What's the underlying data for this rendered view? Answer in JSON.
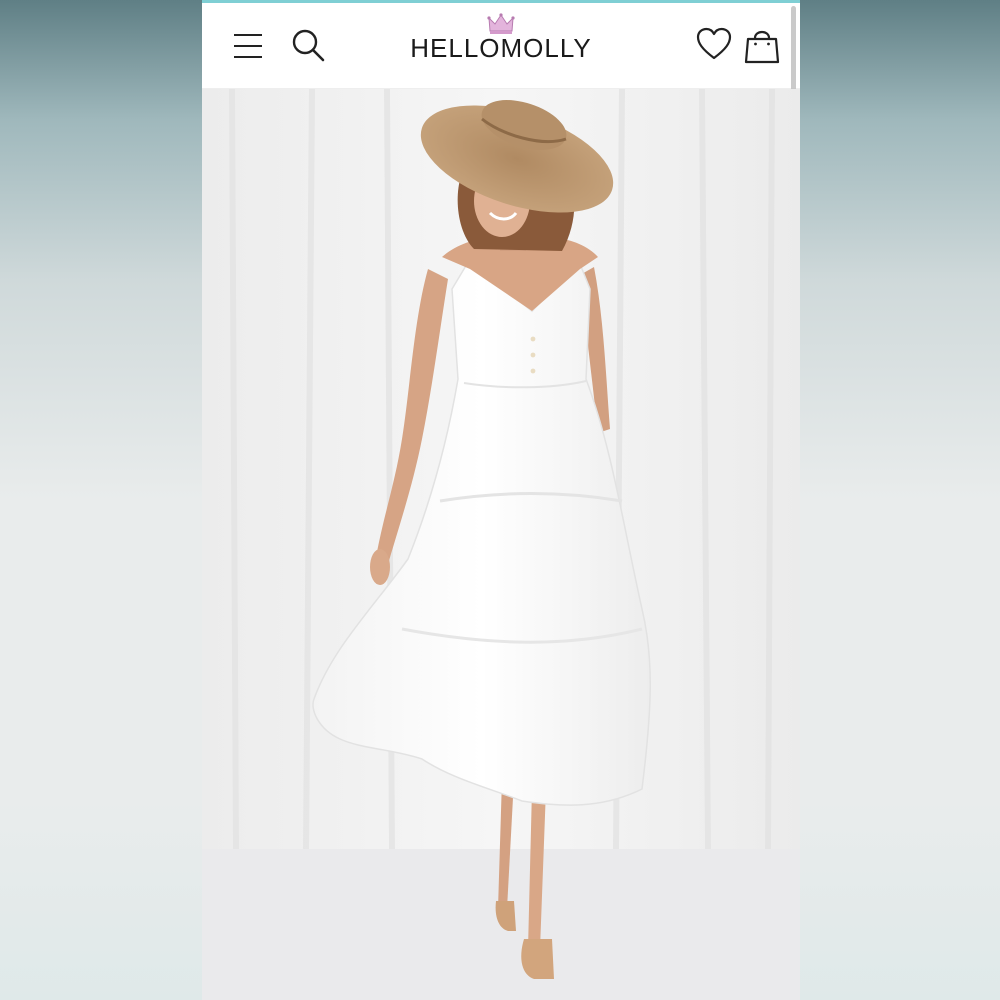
{
  "brand": {
    "name": "HELLOMOLLY",
    "accent": "#d9a6d4"
  },
  "header": {
    "icons": [
      "menu-icon",
      "search-icon",
      "heart-icon",
      "shopping-bag-icon"
    ]
  },
  "colors": {
    "top_stripe": "#7fcfd4",
    "background": "#ffffff",
    "hero_backdrop": "#f1f1f1"
  }
}
